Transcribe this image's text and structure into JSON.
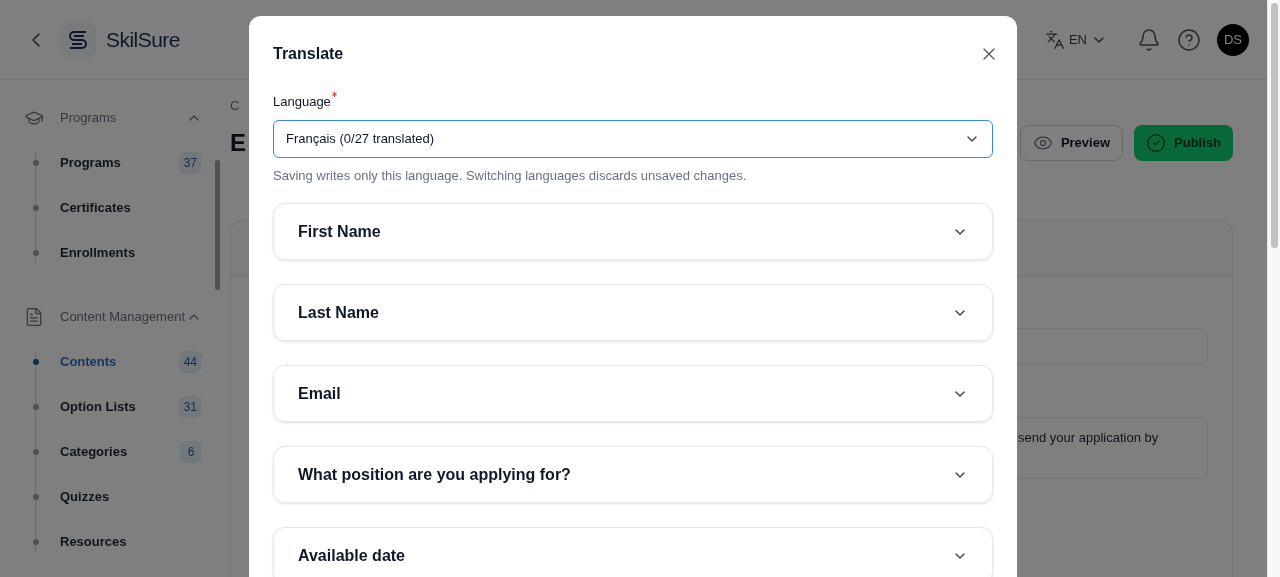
{
  "header": {
    "brand": "SkilSure",
    "language": "EN",
    "avatar": "DS"
  },
  "sidebar": {
    "sections": [
      {
        "kind": "programs",
        "title": "Programs",
        "expanded": true,
        "items": [
          {
            "label": "Programs",
            "count": "37",
            "selected": false
          },
          {
            "label": "Certificates",
            "selected": false
          },
          {
            "label": "Enrollments",
            "selected": false
          }
        ]
      },
      {
        "kind": "content",
        "title": "Content Management",
        "expanded": true,
        "items": [
          {
            "label": "Contents",
            "count": "44",
            "selected": true
          },
          {
            "label": "Option Lists",
            "count": "31",
            "selected": false
          },
          {
            "label": "Categories",
            "count": "6",
            "selected": false
          },
          {
            "label": "Quizzes",
            "selected": false
          },
          {
            "label": "Resources",
            "selected": false
          }
        ]
      }
    ]
  },
  "page": {
    "breadcrumb": "C",
    "heading": "E",
    "buttons": [
      {
        "kind": "preview",
        "label": "Preview"
      },
      {
        "kind": "publish",
        "label": "Publish"
      }
    ],
    "textarea_value": "send your application by"
  },
  "dialog": {
    "title": "Translate",
    "language_label": "Language",
    "required": true,
    "language_value": "Français (0/27 translated)",
    "hint": "Saving writes only this language. Switching languages discards unsaved changes.",
    "fields": [
      {
        "label": "First Name",
        "expanded": false
      },
      {
        "label": "Last Name",
        "expanded": false
      },
      {
        "label": "Email",
        "expanded": false
      },
      {
        "label": "What position are you applying for?",
        "expanded": false
      },
      {
        "label": "Available date",
        "expanded": false
      }
    ]
  }
}
